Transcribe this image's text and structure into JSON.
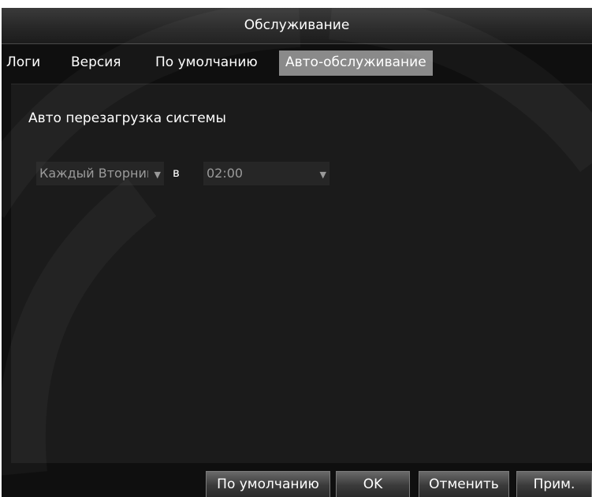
{
  "window": {
    "title": "Обслуживание"
  },
  "tabs": [
    {
      "label": "Логи",
      "active": false
    },
    {
      "label": "Версия",
      "active": false
    },
    {
      "label": "По умолчанию",
      "active": false
    },
    {
      "label": "Авто-обслуживание",
      "active": true
    }
  ],
  "auto_reboot": {
    "label": "Авто перезагрузка системы",
    "day_value": "Каждый Вторник",
    "at_label": "в",
    "time_value": "02:00",
    "arrow_icon": "dropdown-arrow-icon"
  },
  "buttons": {
    "default_label": "По умолчанию",
    "ok_label": "OK",
    "cancel_label": "Отменить",
    "apply_label": "Прим."
  },
  "colors": {
    "background": "#0f0f0f",
    "panel": "#1b1b1b",
    "active_tab": "#8a8a8a",
    "text": "#ffffff",
    "muted_text": "#9a9a9a"
  }
}
